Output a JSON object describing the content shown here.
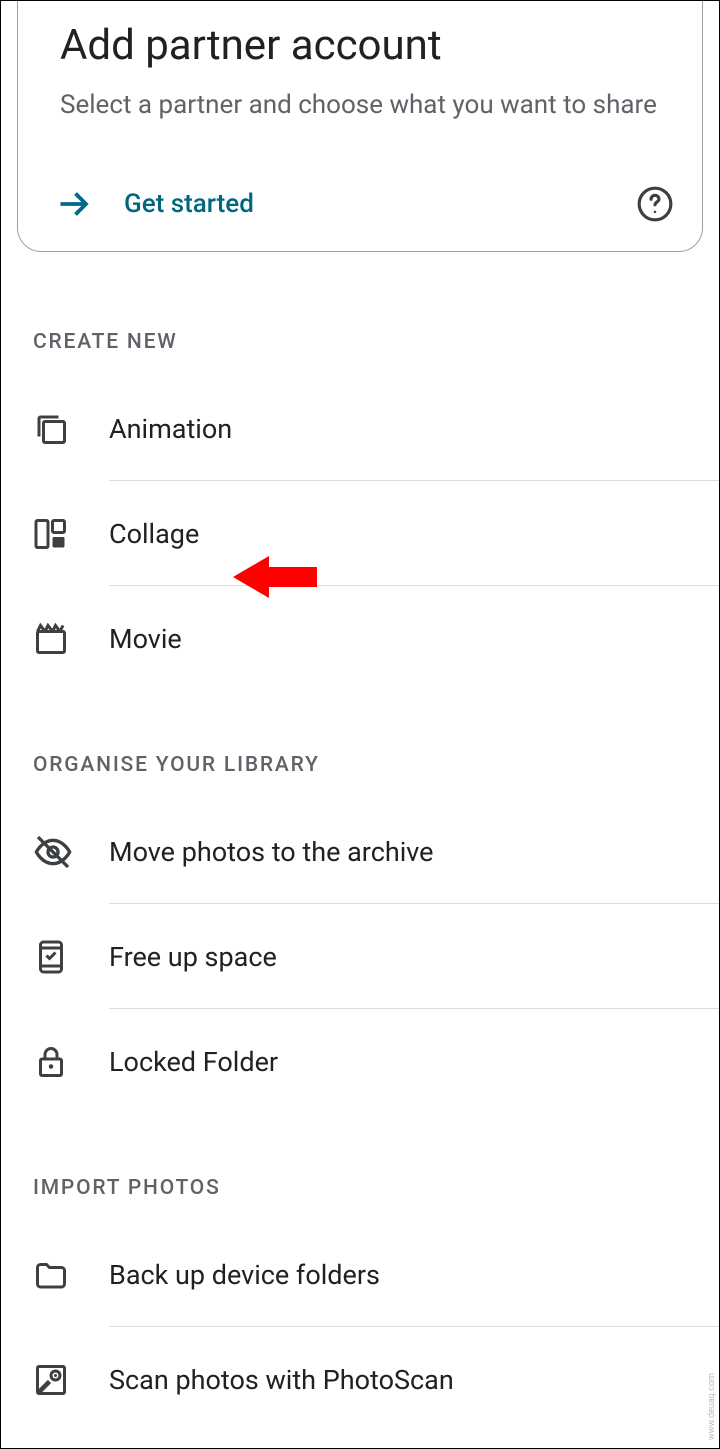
{
  "card": {
    "title": "Add partner account",
    "subtitle": "Select a partner and choose what you want to share",
    "get_started_label": "Get started"
  },
  "sections": {
    "create": {
      "header": "CREATE NEW",
      "items": {
        "animation": "Animation",
        "collage": "Collage",
        "movie": "Movie"
      }
    },
    "organise": {
      "header": "ORGANISE YOUR LIBRARY",
      "items": {
        "archive": "Move photos to the archive",
        "freeup": "Free up space",
        "locked": "Locked Folder"
      }
    },
    "import": {
      "header": "IMPORT PHOTOS",
      "items": {
        "backup": "Back up device folders",
        "scan": "Scan photos with PhotoScan"
      }
    }
  },
  "watermark": "www.deuaq.com"
}
